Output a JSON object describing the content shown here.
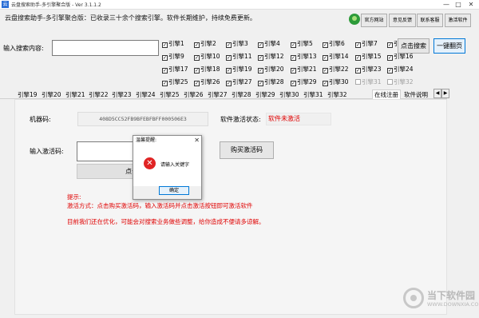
{
  "window": {
    "title": "云盘搜索助手-多引擎聚合版 - Ver 3.1.1.2",
    "minimize": "—",
    "maximize": "□",
    "close": "✕"
  },
  "header": {
    "announcement": "云盘搜索助手-多引擎聚合版：已收录三十余个搜索引擎。软件长期维护，持续免费更新。",
    "buttons": [
      "官方网站",
      "意见反馈",
      "联系客服",
      "激活软件"
    ]
  },
  "search": {
    "label": "输入搜索内容:",
    "value": "",
    "search_button": "点击搜索",
    "one_click_button": "一键翻页"
  },
  "engines": [
    {
      "label": "引擎1",
      "checked": true
    },
    {
      "label": "引擎2",
      "checked": true
    },
    {
      "label": "引擎3",
      "checked": true
    },
    {
      "label": "引擎4",
      "checked": true
    },
    {
      "label": "引擎5",
      "checked": true
    },
    {
      "label": "引擎6",
      "checked": true
    },
    {
      "label": "引擎7",
      "checked": true
    },
    {
      "label": "引擎8",
      "checked": true
    },
    {
      "label": "引擎9",
      "checked": true
    },
    {
      "label": "引擎10",
      "checked": true
    },
    {
      "label": "引擎11",
      "checked": true
    },
    {
      "label": "引擎12",
      "checked": true
    },
    {
      "label": "引擎13",
      "checked": true
    },
    {
      "label": "引擎14",
      "checked": true
    },
    {
      "label": "引擎15",
      "checked": true
    },
    {
      "label": "引擎16",
      "checked": true
    },
    {
      "label": "引擎17",
      "checked": true
    },
    {
      "label": "引擎18",
      "checked": true
    },
    {
      "label": "引擎19",
      "checked": true
    },
    {
      "label": "引擎20",
      "checked": true
    },
    {
      "label": "引擎21",
      "checked": true
    },
    {
      "label": "引擎22",
      "checked": true
    },
    {
      "label": "引擎23",
      "checked": true
    },
    {
      "label": "引擎24",
      "checked": true
    },
    {
      "label": "引擎25",
      "checked": true
    },
    {
      "label": "引擎26",
      "checked": true
    },
    {
      "label": "引擎27",
      "checked": true
    },
    {
      "label": "引擎28",
      "checked": true
    },
    {
      "label": "引擎29",
      "checked": true
    },
    {
      "label": "引擎30",
      "checked": true
    },
    {
      "label": "引擎31",
      "checked": false,
      "disabled": true
    },
    {
      "label": "引擎32",
      "checked": false,
      "disabled": true
    }
  ],
  "tabs": [
    "引擎19",
    "引擎20",
    "引擎21",
    "引擎22",
    "引擎23",
    "引擎24",
    "引擎25",
    "引擎26",
    "引擎27",
    "引擎28",
    "引擎29",
    "引擎30",
    "引擎31",
    "引擎32",
    "在线注册",
    "软件说明"
  ],
  "active_tab": "在线注册",
  "tab_arrows": [
    "◀",
    "▶"
  ],
  "register": {
    "machine_label": "机器码:",
    "machine_code": "408D5CC52FB9BFEBFBFF000506E3",
    "status_label": "软件激活状态:",
    "status_value": "软件未激活",
    "code_label": "输入激活码:",
    "code_value": "",
    "buy_button": "购买激活码",
    "activate_button": "点击激活",
    "tip_title": "提示:",
    "tip_method": "激活方式：点击购买激活码，输入激活码并点击激活按钮即可激活软件",
    "tip_notice": "目前我们还在优化，可能会对搜索业务做些调整，给你造成不便请多谅解。"
  },
  "dialog": {
    "title": "温馨提醒:",
    "close": "✕",
    "message": "请输入关键字",
    "error_icon": "✕",
    "ok_button": "确定"
  },
  "watermark": {
    "name": "当下软件园",
    "url": "WWW.DOWNXIA.COM"
  },
  "colors": {
    "accent": "#0078d7",
    "error": "#e00000",
    "icon_green": "#2d9b3a",
    "error_icon": "#e02424"
  }
}
